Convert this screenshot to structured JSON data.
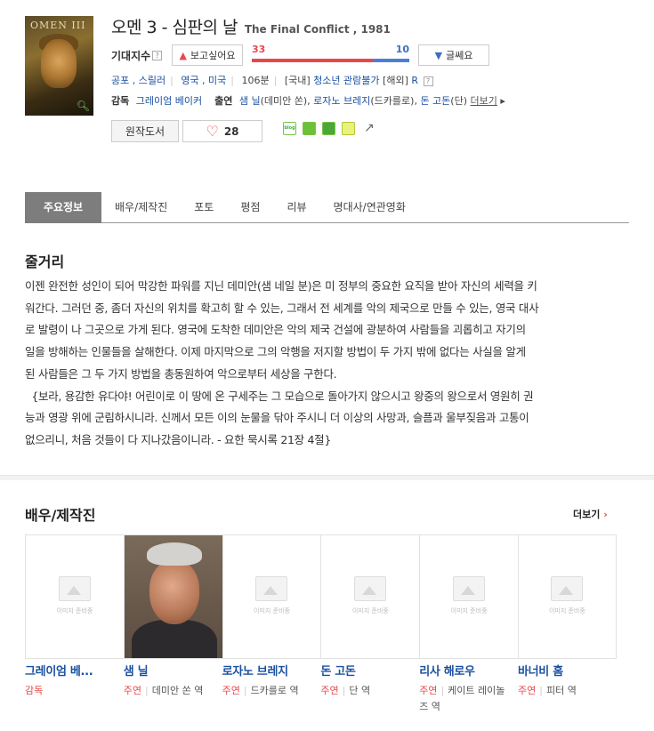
{
  "movie": {
    "title_ko": "오멘 3 - 심판의 날",
    "title_en": "The Final Conflict , 1981",
    "poster_text": "OMEN III",
    "expect_label": "기대지수",
    "help": "?",
    "want_label": "보고싶어요",
    "nah_label": "글쎄요",
    "want_count": "33",
    "nah_count": "10",
    "want_ratio": 0.77,
    "genres": "공포 , 스릴러",
    "countries": "영국 , 미국",
    "runtime": "106분",
    "rating_domestic_label": "[국내]",
    "rating_domestic": "청소년 관람불가",
    "rating_foreign_label": "[해외]",
    "rating_foreign": "R",
    "director_label": "감독",
    "director": "그레이엄 베이커",
    "cast_label": "출연",
    "cast_1": "샘 닐",
    "cast_1_role": "(데미안 쏜), ",
    "cast_2": "로자노 브레지",
    "cast_2_role": "(드카를로), ",
    "cast_3": "돈 고돈",
    "cast_3_role": "(단)",
    "more_label": "더보기",
    "book_label": "원작도서",
    "like_count": "28",
    "blog_label": "blog"
  },
  "tabs": [
    "주요정보",
    "배우/제작진",
    "포토",
    "평점",
    "리뷰",
    "명대사/연관영화"
  ],
  "synopsis": {
    "heading": "줄거리",
    "lines": [
      "이젠 완전한 성인이 되어 막강한 파워를 지닌 데미안(샘 네일 분)은 미 정부의 중요한 요직을 받아 자신의 세력을 키",
      "워간다. 그러던 중, 좀더 자신의 위치를 확고히 할 수 있는, 그래서 전 세계를 악의 제국으로 만들 수 있는, 영국 대사",
      "로 발령이 나 그곳으로 가게 된다. 영국에 도착한 데미안은 악의 제국 건설에 광분하여 사람들을 괴롭히고 자기의",
      "일을 방해하는 인물들을 살해한다. 이제 마지막으로 그의 악행을 저지할 방법이 두 가지 밖에 없다는 사실을 알게",
      "된 사람들은 그 두 가지 방법을 총동원하여 악으로부터 세상을 구한다.",
      "  {보라, 용감한 유다야! 어린이로 이 땅에 온 구세주는 그 모습으로 돌아가지 않으시고 왕중의 왕으로서 영원히 권",
      "능과 영광 위에 군림하시니라. 신께서 모든 이의 눈물을 닦아 주시니 더 이상의 사망과, 슬픔과 울부짖음과 고통이",
      "없으리니, 처음 것들이 다 지나갔음이니라. - 요한 묵시록 21장 4절}"
    ]
  },
  "crew_section": {
    "heading": "배우/제작진",
    "more_label": "더보기",
    "no_image_caption": "이미지 준비중",
    "people": [
      {
        "name": "그레이엄 베...",
        "role": "감독",
        "char": ""
      },
      {
        "name": "샘 닐",
        "role": "주연",
        "char": "데미안 쏜 역"
      },
      {
        "name": "로자노 브레지",
        "role": "주연",
        "char": "드카를로 역"
      },
      {
        "name": "돈 고돈",
        "role": "주연",
        "char": "단 역"
      },
      {
        "name": "리사 해로우",
        "role": "주연",
        "char": "케이트 레이놀즈 역"
      },
      {
        "name": "바너비 홈",
        "role": "주연",
        "char": "피터 역"
      }
    ]
  },
  "colors": {
    "accent_red": "#e8474c",
    "accent_blue": "#3d6fc1",
    "link_blue": "#1b50a1",
    "tab_active": "#7d7d7d"
  }
}
